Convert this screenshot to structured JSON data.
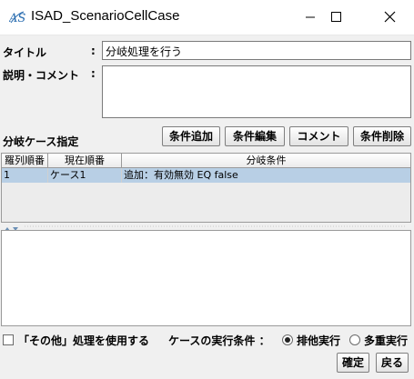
{
  "window": {
    "title": "ISAD_ScenarioCellCase",
    "controls": [
      "minimize-icon",
      "maximize-icon",
      "close-icon"
    ]
  },
  "form": {
    "title_label": "タイトル",
    "colon": ":",
    "title_value": "分岐処理を行う",
    "desc_label": "説明・コメント",
    "desc_value": ""
  },
  "cases": {
    "section_label": "分岐ケース指定",
    "buttons": {
      "add": "条件追加",
      "edit": "条件編集",
      "comment": "コメント",
      "delete": "条件削除"
    },
    "columns": [
      "羅列順番",
      "現在順番",
      "分岐条件"
    ],
    "rows": [
      [
        "1",
        "ケース1",
        "追加：有効無効 EQ false"
      ]
    ]
  },
  "options": {
    "else_label": "「その他」処理を使用する",
    "else_checked": false,
    "exec_label": "ケースの実行条件 ：",
    "radio_exclusive": "排他実行",
    "radio_multiple": "多重実行",
    "selected": "排他実行"
  },
  "footer": {
    "ok": "確定",
    "back": "戻る"
  },
  "colors": {
    "selection": "#b8cfe5",
    "window_bg": "#f0f0f0"
  }
}
